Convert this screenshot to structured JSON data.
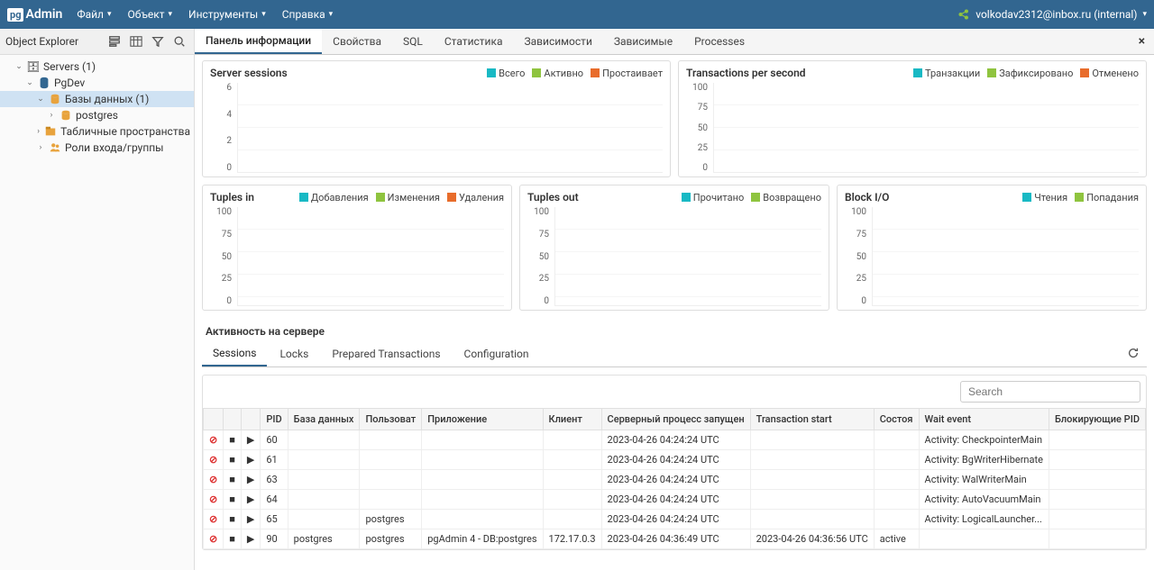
{
  "brand": {
    "pg": "pg",
    "admin": "Admin"
  },
  "menu": {
    "file": "Файл",
    "object": "Объект",
    "tools": "Инструменты",
    "help": "Справка"
  },
  "user": {
    "email": "volkodav2312@inbox.ru (internal)"
  },
  "sidebar": {
    "title": "Object Explorer",
    "tree": {
      "servers": "Servers (1)",
      "pgdev": "PgDev",
      "databases": "Базы данных (1)",
      "postgres": "postgres",
      "tablespaces": "Табличные пространства",
      "roles": "Роли входа/группы"
    }
  },
  "tabs": {
    "info": "Панель информации",
    "props": "Свойства",
    "sql": "SQL",
    "stats": "Статистика",
    "deps": "Зависимости",
    "depn": "Зависимые",
    "proc": "Processes"
  },
  "charts": {
    "sessions": {
      "title": "Server sessions",
      "legend": [
        "Всего",
        "Активно",
        "Простаивает"
      ],
      "colors": [
        "#18b9c4",
        "#8fc43f",
        "#e86c2b"
      ],
      "y": [
        "6",
        "4",
        "2",
        "0"
      ]
    },
    "tps": {
      "title": "Transactions per second",
      "legend": [
        "Транзакции",
        "Зафиксировано",
        "Отменено"
      ],
      "colors": [
        "#18b9c4",
        "#8fc43f",
        "#e86c2b"
      ],
      "y": [
        "100",
        "75",
        "50",
        "25",
        "0"
      ]
    },
    "tin": {
      "title": "Tuples in",
      "legend": [
        "Добавления",
        "Изменения",
        "Удаления"
      ],
      "colors": [
        "#18b9c4",
        "#8fc43f",
        "#e86c2b"
      ],
      "y": [
        "100",
        "75",
        "50",
        "25",
        "0"
      ]
    },
    "tout": {
      "title": "Tuples out",
      "legend": [
        "Прочитано",
        "Возвращено"
      ],
      "colors": [
        "#18b9c4",
        "#8fc43f"
      ],
      "y": [
        "100",
        "75",
        "50",
        "25",
        "0"
      ]
    },
    "bio": {
      "title": "Block I/O",
      "legend": [
        "Чтения",
        "Попадания"
      ],
      "colors": [
        "#18b9c4",
        "#8fc43f"
      ],
      "y": [
        "100",
        "75",
        "50",
        "25",
        "0"
      ]
    }
  },
  "activity": {
    "title": "Активность на сервере",
    "subtabs": {
      "sessions": "Sessions",
      "locks": "Locks",
      "prep": "Prepared Transactions",
      "conf": "Configuration"
    },
    "search_placeholder": "Search",
    "cols": {
      "pid": "PID",
      "db": "База данных",
      "user": "Пользоват",
      "app": "Приложение",
      "client": "Клиент",
      "backend": "Серверный процесс запущен",
      "txn": "Transaction start",
      "state": "Состоя",
      "wait": "Wait event",
      "block": "Блокирующие PID"
    },
    "rows": [
      {
        "pid": "60",
        "db": "",
        "user": "",
        "app": "",
        "client": "",
        "backend": "2023-04-26 04:24:24 UTC",
        "txn": "",
        "state": "",
        "wait": "Activity: CheckpointerMain"
      },
      {
        "pid": "61",
        "db": "",
        "user": "",
        "app": "",
        "client": "",
        "backend": "2023-04-26 04:24:24 UTC",
        "txn": "",
        "state": "",
        "wait": "Activity: BgWriterHibernate"
      },
      {
        "pid": "63",
        "db": "",
        "user": "",
        "app": "",
        "client": "",
        "backend": "2023-04-26 04:24:24 UTC",
        "txn": "",
        "state": "",
        "wait": "Activity: WalWriterMain"
      },
      {
        "pid": "64",
        "db": "",
        "user": "",
        "app": "",
        "client": "",
        "backend": "2023-04-26 04:24:24 UTC",
        "txn": "",
        "state": "",
        "wait": "Activity: AutoVacuumMain"
      },
      {
        "pid": "65",
        "db": "",
        "user": "postgres",
        "app": "",
        "client": "",
        "backend": "2023-04-26 04:24:24 UTC",
        "txn": "",
        "state": "",
        "wait": "Activity: LogicalLauncher..."
      },
      {
        "pid": "90",
        "db": "postgres",
        "user": "postgres",
        "app": "pgAdmin 4 - DB:postgres",
        "client": "172.17.0.3",
        "backend": "2023-04-26 04:36:49 UTC",
        "txn": "2023-04-26 04:36:56 UTC",
        "state": "active",
        "wait": ""
      }
    ]
  },
  "chart_data": [
    {
      "type": "line",
      "title": "Server sessions",
      "series": [
        {
          "name": "Всего",
          "values": []
        },
        {
          "name": "Активно",
          "values": []
        },
        {
          "name": "Простаивает",
          "values": []
        }
      ],
      "ylim": [
        0,
        6
      ]
    },
    {
      "type": "line",
      "title": "Transactions per second",
      "series": [
        {
          "name": "Транзакции",
          "values": []
        },
        {
          "name": "Зафиксировано",
          "values": []
        },
        {
          "name": "Отменено",
          "values": []
        }
      ],
      "ylim": [
        0,
        100
      ]
    },
    {
      "type": "line",
      "title": "Tuples in",
      "series": [
        {
          "name": "Добавления",
          "values": []
        },
        {
          "name": "Изменения",
          "values": []
        },
        {
          "name": "Удаления",
          "values": []
        }
      ],
      "ylim": [
        0,
        100
      ]
    },
    {
      "type": "line",
      "title": "Tuples out",
      "series": [
        {
          "name": "Прочитано",
          "values": []
        },
        {
          "name": "Возвращено",
          "values": []
        }
      ],
      "ylim": [
        0,
        100
      ]
    },
    {
      "type": "line",
      "title": "Block I/O",
      "series": [
        {
          "name": "Чтения",
          "values": []
        },
        {
          "name": "Попадания",
          "values": []
        }
      ],
      "ylim": [
        0,
        100
      ]
    }
  ]
}
